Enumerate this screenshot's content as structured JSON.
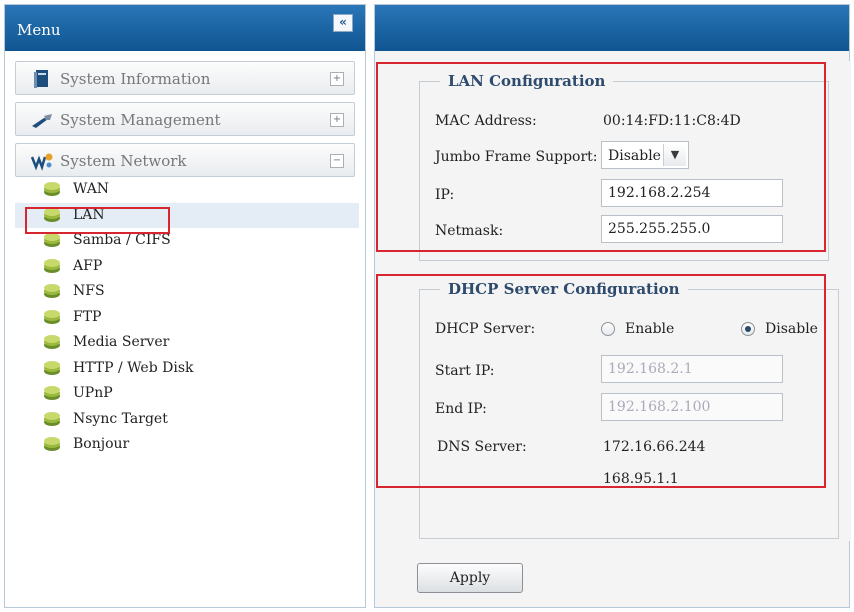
{
  "menu": {
    "title": "Menu",
    "collapse_label": "«",
    "sections": [
      {
        "label": "System Information",
        "toggle": "+"
      },
      {
        "label": "System Management",
        "toggle": "+"
      },
      {
        "label": "System Network",
        "toggle": "−"
      }
    ],
    "network_items": [
      "WAN",
      "LAN",
      "Samba / CIFS",
      "AFP",
      "NFS",
      "FTP",
      "Media Server",
      "HTTP / Web Disk",
      "UPnP",
      "Nsync Target",
      "Bonjour"
    ],
    "selected_item": "LAN"
  },
  "lan": {
    "title": "LAN Configuration",
    "mac_label": "MAC Address:",
    "mac_value": "00:14:FD:11:C8:4D",
    "jumbo_label": "Jumbo Frame Support:",
    "jumbo_value": "Disable",
    "ip_label": "IP:",
    "ip_value": "192.168.2.254",
    "netmask_label": "Netmask:",
    "netmask_value": "255.255.255.0"
  },
  "dhcp": {
    "title": "DHCP Server Configuration",
    "server_label": "DHCP Server:",
    "enable_label": "Enable",
    "disable_label": "Disable",
    "selected": "Disable",
    "start_label": "Start IP:",
    "start_value": "192.168.2.1",
    "end_label": "End IP:",
    "end_value": "192.168.2.100",
    "dns_label": "DNS Server:",
    "dns_values": [
      "172.16.66.244",
      "168.95.1.1"
    ]
  },
  "actions": {
    "apply_label": "Apply"
  },
  "colors": {
    "header_blue": "#1563a6",
    "highlight_red": "#d72630",
    "selected_bg": "#e4edf6"
  }
}
